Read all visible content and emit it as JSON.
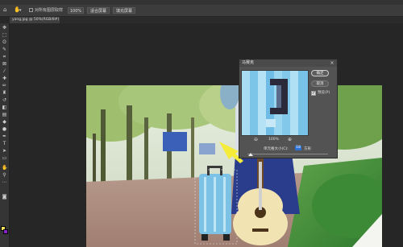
{
  "options_bar": {
    "sample_all_layers_label": "对所有图层取样",
    "zoom_100_label": "100%",
    "fit_screen_label": "适合屏幕",
    "fill_screen_label": "填充屏幕"
  },
  "document_tab": {
    "title": "yang.jpg @ 50%(RGB/8#) *"
  },
  "dialog": {
    "title": "马赛克",
    "close": "×",
    "ok_label": "确定",
    "cancel_label": "取消",
    "preview_label": "预览(P)",
    "preview_checked": "✓",
    "zoom_out": "⊖",
    "zoom_in": "⊕",
    "zoom_level": "100%",
    "cell_size_label": "单元格大小(C):",
    "cell_size_value": "18",
    "cell_size_unit": "方形"
  },
  "colors": {
    "foreground": "#f2e05a",
    "background": "#8a22c8",
    "arrow": "#f5ec3a"
  },
  "icons": {
    "home": "home-icon",
    "hand": "hand-icon"
  }
}
